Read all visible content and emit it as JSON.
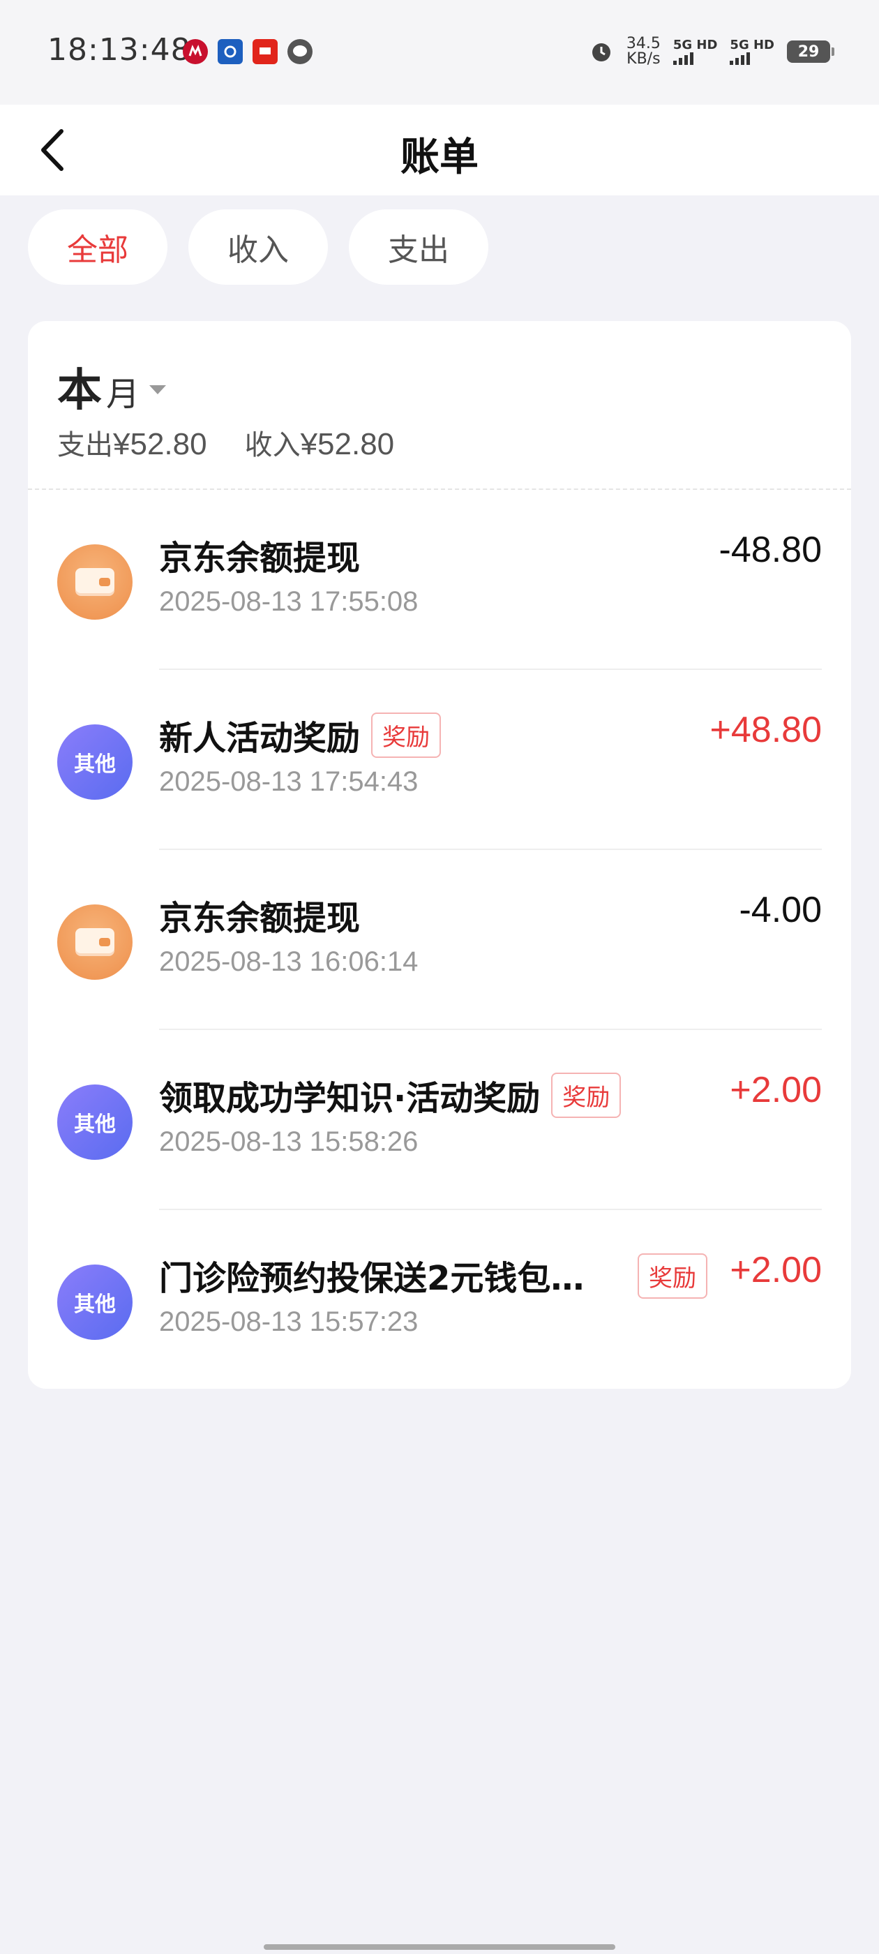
{
  "status_bar": {
    "time": "18:13:48",
    "speed_value": "34.5",
    "speed_unit": "KB/s",
    "net1": "5G HD",
    "net2": "5G HD",
    "battery": "29",
    "app_icons": [
      "cmb-icon",
      "ccb-icon",
      "jd-app-icon",
      "message-icon"
    ]
  },
  "header": {
    "title": "账单"
  },
  "tabs": [
    {
      "label": "全部",
      "active": true
    },
    {
      "label": "收入",
      "active": false
    },
    {
      "label": "支出",
      "active": false
    }
  ],
  "summary": {
    "month_big": "本",
    "month_small": "月",
    "expense_label": "支出",
    "expense_value": "¥52.80",
    "income_label": "收入",
    "income_value": "¥52.80"
  },
  "transactions": [
    {
      "icon": "wallet-icon",
      "title": "京东余额提现",
      "badge": "",
      "time": "2025-08-13 17:55:08",
      "amount": "-48.80",
      "type": "expense"
    },
    {
      "icon": "other",
      "icon_text": "其他",
      "title": "新人活动奖励",
      "badge": "奖励",
      "time": "2025-08-13 17:54:43",
      "amount": "+48.80",
      "type": "income"
    },
    {
      "icon": "wallet-icon",
      "title": "京东余额提现",
      "badge": "",
      "time": "2025-08-13 16:06:14",
      "amount": "-4.00",
      "type": "expense"
    },
    {
      "icon": "other",
      "icon_text": "其他",
      "title": "领取成功学知识·活动奖励",
      "badge": "奖励",
      "time": "2025-08-13 15:58:26",
      "amount": "+2.00",
      "type": "income"
    },
    {
      "icon": "other",
      "icon_text": "其他",
      "title": "门诊险预约投保送2元钱包…",
      "badge": "奖励",
      "time": "2025-08-13 15:57:23",
      "amount": "+2.00",
      "type": "income"
    }
  ],
  "colors": {
    "accent": "#e83a3a",
    "background": "#f2f2f7",
    "card": "#ffffff",
    "wallet": "#ee8f4b",
    "other": "#6a70f2"
  }
}
